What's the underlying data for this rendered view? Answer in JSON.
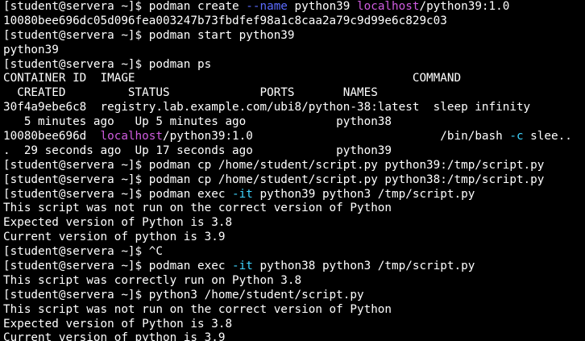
{
  "terminal": {
    "colors": {
      "background": "#000000",
      "foreground": "#ffffff",
      "option": "#5b6cff",
      "host": "#d05ce0",
      "flag": "#3fd5ff"
    },
    "lines": [
      [
        {
          "t": "[student@servera ~]$ podman create "
        },
        {
          "t": "--name",
          "c": "blue"
        },
        {
          "t": " python39 "
        },
        {
          "t": "localhost",
          "c": "magenta"
        },
        {
          "t": "/python39:1.0"
        }
      ],
      [
        {
          "t": "10080bee696dc05d096fea003247b73fbdfef98a1c8caa2a79c9d99e6c829c03"
        }
      ],
      [
        {
          "t": "[student@servera ~]$ podman start python39"
        }
      ],
      [
        {
          "t": "python39"
        }
      ],
      [
        {
          "t": "[student@servera ~]$ podman ps"
        }
      ],
      [
        {
          "t": "CONTAINER ID  IMAGE                                        COMMAND"
        }
      ],
      [
        {
          "t": "  CREATED         STATUS             PORTS       NAMES"
        }
      ],
      [
        {
          "t": "30f4a9ebe6c8  registry.lab.example.com/ubi8/python-38:latest  sleep infinity"
        }
      ],
      [
        {
          "t": "   5 minutes ago   Up 5 minutes ago             python38"
        }
      ],
      [
        {
          "t": "10080bee696d  "
        },
        {
          "t": "localhost",
          "c": "magenta"
        },
        {
          "t": "/python39:1.0                           /bin/bash "
        },
        {
          "t": "-c",
          "c": "cyan"
        },
        {
          "t": " slee.."
        }
      ],
      [
        {
          "t": ".  29 seconds ago  Up 17 seconds ago            python39"
        }
      ],
      [
        {
          "t": "[student@servera ~]$ podman cp /home/student/script.py python39:/tmp/script.py"
        }
      ],
      [
        {
          "t": "[student@servera ~]$ podman cp /home/student/script.py python38:/tmp/script.py"
        }
      ],
      [
        {
          "t": "[student@servera ~]$ podman exec "
        },
        {
          "t": "-it",
          "c": "cyan"
        },
        {
          "t": " python39 python3 /tmp/script.py"
        }
      ],
      [
        {
          "t": "This script was not run on the correct version of Python"
        }
      ],
      [
        {
          "t": "Expected version of Python is 3.8"
        }
      ],
      [
        {
          "t": "Current version of python is 3.9"
        }
      ],
      [
        {
          "t": "[student@servera ~]$ ^C"
        }
      ],
      [
        {
          "t": "[student@servera ~]$ podman exec "
        },
        {
          "t": "-it",
          "c": "cyan"
        },
        {
          "t": " python38 python3 /tmp/script.py"
        }
      ],
      [
        {
          "t": "This script was correctly run on Python 3.8"
        }
      ],
      [
        {
          "t": "[student@servera ~]$ python3 /home/student/script.py"
        }
      ],
      [
        {
          "t": "This script was not run on the correct version of Python"
        }
      ],
      [
        {
          "t": "Expected version of Python is 3.8"
        }
      ],
      [
        {
          "t": "Current version of python is 3.9"
        }
      ]
    ]
  }
}
